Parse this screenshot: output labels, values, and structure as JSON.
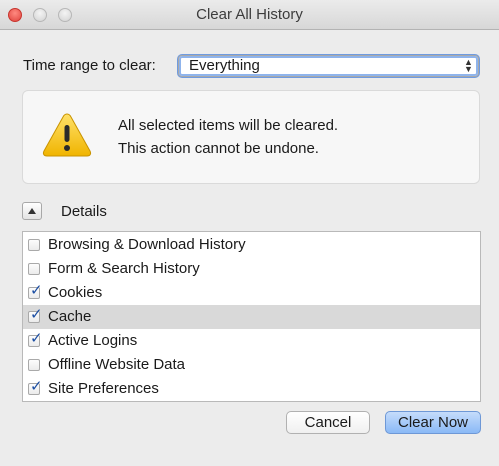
{
  "window": {
    "title": "Clear All History"
  },
  "time_range": {
    "label": "Time range to clear:",
    "selected": "Everything"
  },
  "warning": {
    "line1": "All selected items will be cleared.",
    "line2": "This action cannot be undone."
  },
  "details": {
    "label": "Details",
    "expanded": true
  },
  "items": [
    {
      "label": "Browsing & Download History",
      "checked": false,
      "selected": false
    },
    {
      "label": "Form & Search History",
      "checked": false,
      "selected": false
    },
    {
      "label": "Cookies",
      "checked": true,
      "selected": false
    },
    {
      "label": "Cache",
      "checked": true,
      "selected": true
    },
    {
      "label": "Active Logins",
      "checked": true,
      "selected": false
    },
    {
      "label": "Offline Website Data",
      "checked": false,
      "selected": false
    },
    {
      "label": "Site Preferences",
      "checked": true,
      "selected": false
    }
  ],
  "buttons": {
    "cancel": "Cancel",
    "clear_now": "Clear Now"
  },
  "colors": {
    "accent": "#8ab9f6",
    "check": "#1d4fa3",
    "warning": "#f5c518"
  }
}
